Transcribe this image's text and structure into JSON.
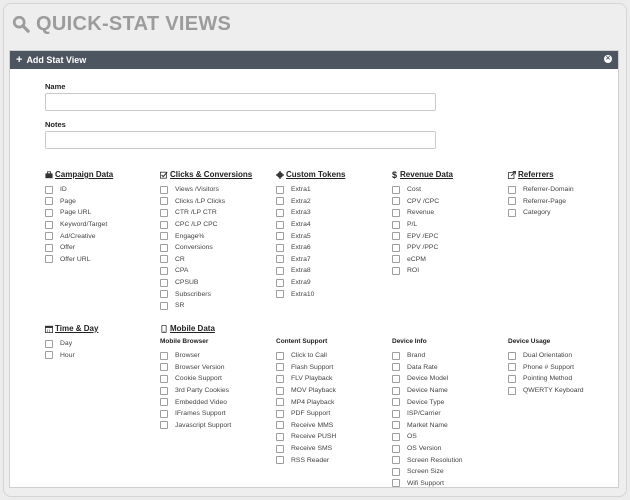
{
  "page": {
    "title": "QUICK-STAT VIEWS"
  },
  "panel": {
    "header_label": "Add Stat View",
    "name_label": "Name",
    "name_value": "",
    "notes_label": "Notes",
    "notes_value": ""
  },
  "groups": {
    "campaign": {
      "title": "Campaign Data",
      "options": [
        "ID",
        "Page",
        "Page URL",
        "Keyword/Target",
        "Ad/Creative",
        "Offer",
        "Offer URL"
      ]
    },
    "clicks": {
      "title": "Clicks & Conversions",
      "options": [
        "Views /Visitors",
        "Clicks /LP Clicks",
        "CTR /LP CTR",
        "CPC /LP CPC",
        "Engage%",
        "Conversions",
        "CR",
        "CPA",
        "CPSUB",
        "Subscribers",
        "SR"
      ]
    },
    "tokens": {
      "title": "Custom Tokens",
      "options": [
        "Extra1",
        "Extra2",
        "Extra3",
        "Extra4",
        "Extra5",
        "Extra6",
        "Extra7",
        "Extra8",
        "Extra9",
        "Extra10"
      ]
    },
    "revenue": {
      "title": "Revenue Data",
      "options": [
        "Cost",
        "CPV /CPC",
        "Revenue",
        "P/L",
        "EPV /EPC",
        "PPV /PPC",
        "eCPM",
        "ROI"
      ]
    },
    "referrers": {
      "title": "Referrers",
      "options": [
        "Referrer-Domain",
        "Referrer-Page",
        "Category"
      ]
    },
    "time": {
      "title": "Time & Day",
      "options": [
        "Day",
        "Hour"
      ]
    },
    "mobile": {
      "title": "Mobile Data"
    },
    "mobile_browser": {
      "title": "Mobile Browser",
      "options": [
        "Browser",
        "Browser Version",
        "Cookie Support",
        "3rd Party Cookies",
        "Embedded Video",
        "IFrames Support",
        "Javascript Support"
      ]
    },
    "content": {
      "title": "Content Support",
      "options": [
        "Click to Call",
        "Flash Support",
        "FLV Playback",
        "MOV Playback",
        "MP4 Playback",
        "PDF Support",
        "Receive MMS",
        "Receive PUSH",
        "Receive SMS",
        "RSS Reader"
      ]
    },
    "device_info": {
      "title": "Device Info",
      "options": [
        "Brand",
        "Data Rate",
        "Device Model",
        "Device Name",
        "Device Type",
        "ISP/Carrier",
        "Market Name",
        "OS",
        "OS Version",
        "Screen Resolution",
        "Screen Size",
        "Wifi Support"
      ]
    },
    "device_usage": {
      "title": "Device Usage",
      "options": [
        "Dual Orientation",
        "Phone # Support",
        "Pointing Method",
        "QWERTY Keyboard"
      ]
    }
  },
  "colors": {
    "header_bar": "#4d5560",
    "title_gray": "#9c9c9c",
    "background": "#eeeeee"
  }
}
